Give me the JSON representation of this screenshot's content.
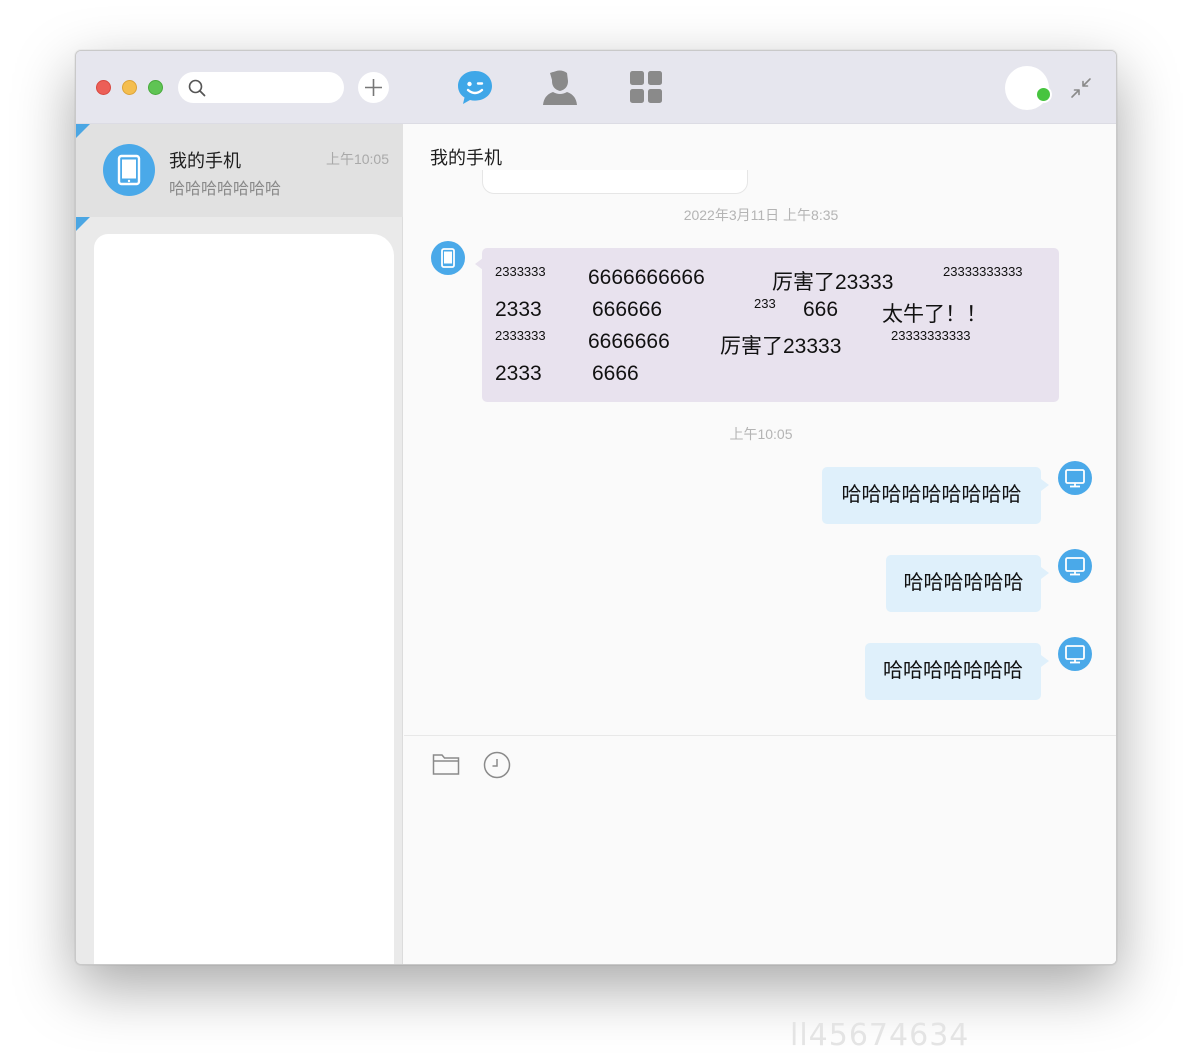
{
  "search": {
    "placeholder": ""
  },
  "titlebar": {
    "nav": [
      "chat-icon",
      "contacts-icon",
      "apps-grid-icon"
    ],
    "status_color": "#47c43f"
  },
  "sidebar": {
    "session": {
      "name": "我的手机",
      "time": "上午10:05",
      "preview": "哈哈哈哈哈哈哈"
    }
  },
  "chat": {
    "title": "我的手机",
    "timestamp_1": "2022年3月11日  上午8:35",
    "incoming": {
      "row1": [
        "2333333",
        "6666666666",
        "厉害了23333",
        "23333333333"
      ],
      "row2": [
        "2333",
        "666666",
        "233",
        "666",
        "太牛了！！"
      ],
      "row3": [
        "2333333",
        "6666666",
        "厉害了23333",
        "23333333333"
      ],
      "row4": [
        "2333",
        "6666"
      ]
    },
    "timestamp_2": "上午10:05",
    "outgoing": [
      "哈哈哈哈哈哈哈哈哈",
      "哈哈哈哈哈哈",
      "哈哈哈哈哈哈哈"
    ]
  },
  "composer": {
    "value": ""
  },
  "watermark": "ll45674634"
}
